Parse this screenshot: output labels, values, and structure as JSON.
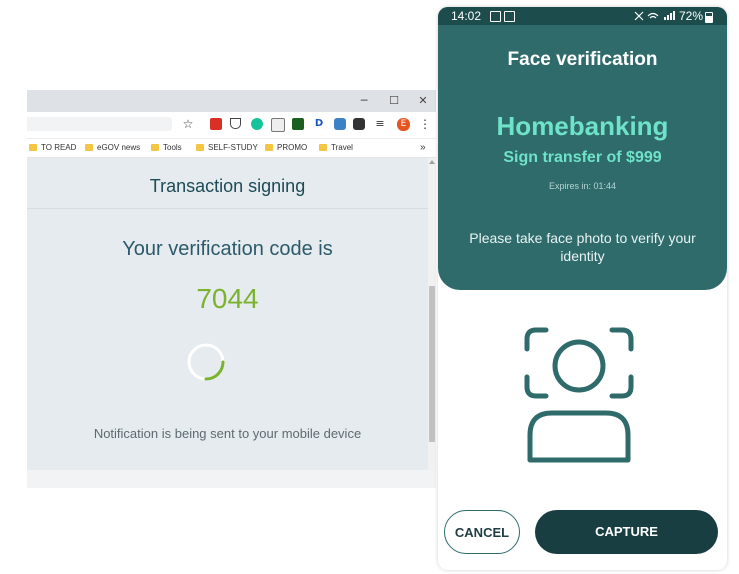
{
  "browser": {
    "window_controls": {
      "minimize": "─",
      "maximize": "☐",
      "close": "✕"
    },
    "toolbar": {
      "star": "☆",
      "profile_initial": "E",
      "menu": "⋮"
    },
    "bookmarks": [
      {
        "label": "TO READ"
      },
      {
        "label": "eGOV news"
      },
      {
        "label": "Tools"
      },
      {
        "label": "SELF-STUDY"
      },
      {
        "label": "PROMO"
      },
      {
        "label": "Travel"
      }
    ],
    "bookmarks_more": "»",
    "page": {
      "title": "Transaction signing",
      "code_label": "Your verification code is",
      "code": "7044",
      "notification": "Notification is being sent to your mobile device"
    }
  },
  "phone": {
    "status": {
      "time": "14:02",
      "battery": "72%"
    },
    "title": "Face verification",
    "app_name": "Homebanking",
    "transfer": "Sign transfer of $999",
    "expires": "Expires in: 01:44",
    "instruction": "Please take face photo to verify your identity",
    "buttons": {
      "cancel": "CANCEL",
      "capture": "CAPTURE"
    }
  },
  "colors": {
    "accent_green": "#7bb32e",
    "phone_header": "#2f6b6b",
    "phone_highlight": "#6fe3c9",
    "capture_button": "#183e42"
  }
}
